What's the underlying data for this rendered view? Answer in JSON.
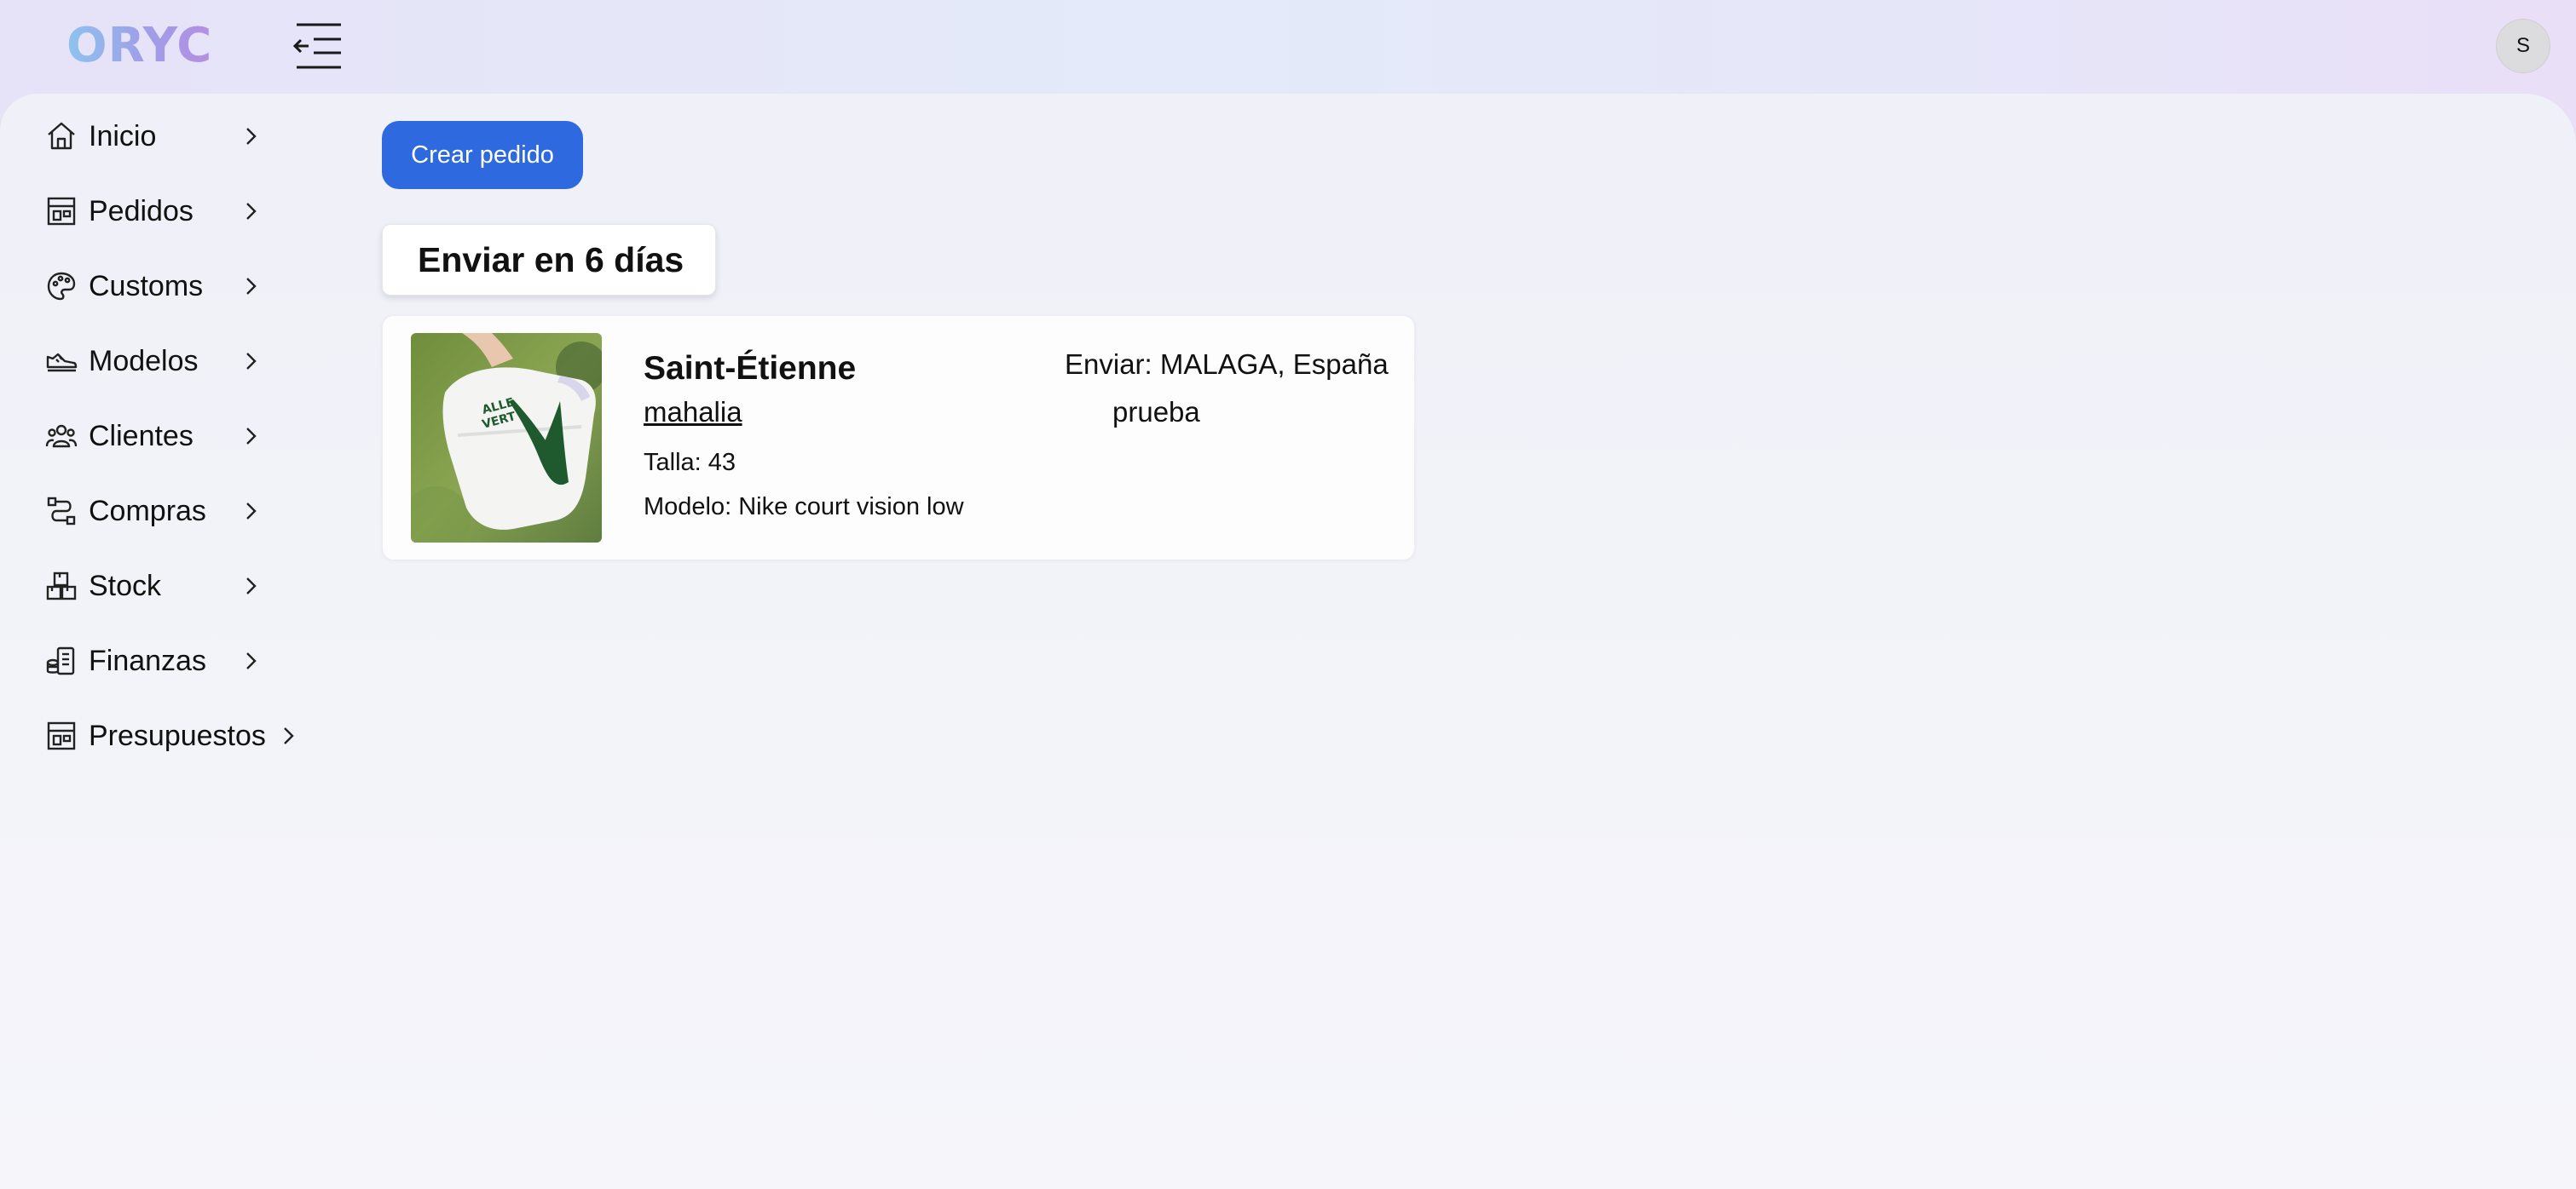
{
  "app": {
    "logo_text": "ORYC",
    "avatar_initial": "S"
  },
  "sidebar": {
    "items": [
      {
        "label": "Inicio",
        "icon": "home-icon"
      },
      {
        "label": "Pedidos",
        "icon": "store-icon"
      },
      {
        "label": "Customs",
        "icon": "palette-icon"
      },
      {
        "label": "Modelos",
        "icon": "sneaker-icon"
      },
      {
        "label": "Clientes",
        "icon": "users-icon"
      },
      {
        "label": "Compras",
        "icon": "route-icon"
      },
      {
        "label": "Stock",
        "icon": "boxes-icon"
      },
      {
        "label": "Finanzas",
        "icon": "coins-icon"
      },
      {
        "label": "Presupuestos",
        "icon": "store-icon"
      }
    ]
  },
  "toolbar": {
    "create_label": "Crear pedido"
  },
  "section": {
    "title": "Enviar en 6 días"
  },
  "order": {
    "title": "Saint-Étienne",
    "client": "mahalia",
    "size": "Talla: 43",
    "model": "Modelo: Nike court vision low",
    "ship_to": "Enviar: MALAGA, España",
    "note": "prueba",
    "image_icon": "sneaker-photo"
  },
  "colors": {
    "primary": "#2f69e0",
    "swoosh": "#1f5a2e"
  }
}
